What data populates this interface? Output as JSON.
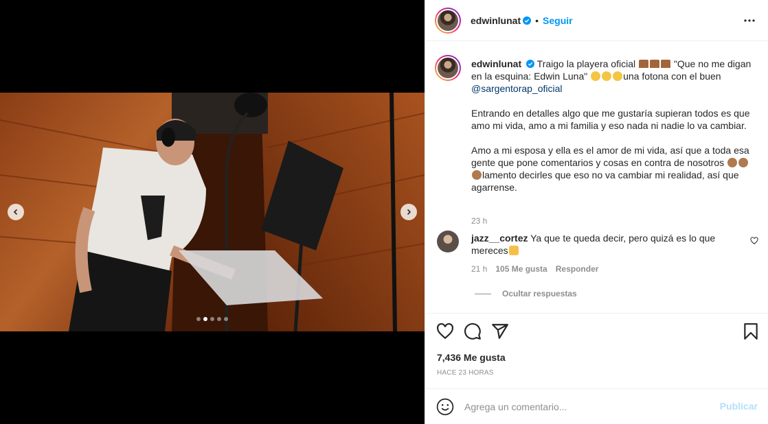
{
  "post": {
    "author": "edwinlunat",
    "follow_label": "Seguir",
    "separator": "•",
    "caption": {
      "part1": "Traigo la playera oficial",
      "part2": "\"Que no me digan en la esquina: Edwin Luna\"",
      "part3": "una fotona con el buen",
      "mention": "@sargentorap_oficial",
      "paragraph2": "Entrando en detalles algo que me gustaría supieran todos es que amo mi vida, amo a mi familia y eso nada ni nadie lo va cambiar.",
      "paragraph3a": "Amo a mi esposa y ella es el amor de mi vida, así que a toda esa gente que pone comentarios y cosas en contra de nosotros",
      "paragraph3b": "lamento decirles que eso no va cambiar mi realidad, así que agarrense."
    },
    "caption_time": "23 h",
    "comment": {
      "username": "jazz__cortez",
      "text": "Ya que te queda decir, pero quizá es lo que mereces",
      "time": "21 h",
      "likes": "105 Me gusta",
      "reply_label": "Responder"
    },
    "hide_replies_label": "Ocultar respuestas",
    "likes_count": "7,436 Me gusta",
    "posted_ago": "HACE 23 HORAS",
    "add_comment_placeholder": "Agrega un comentario...",
    "publish_label": "Publicar",
    "carousel": {
      "total": 5,
      "active_index": 1
    }
  },
  "colors": {
    "accent": "#0095f6",
    "publish_disabled": "#b2dffc",
    "muted": "#8e8e8e",
    "text": "#262626"
  }
}
